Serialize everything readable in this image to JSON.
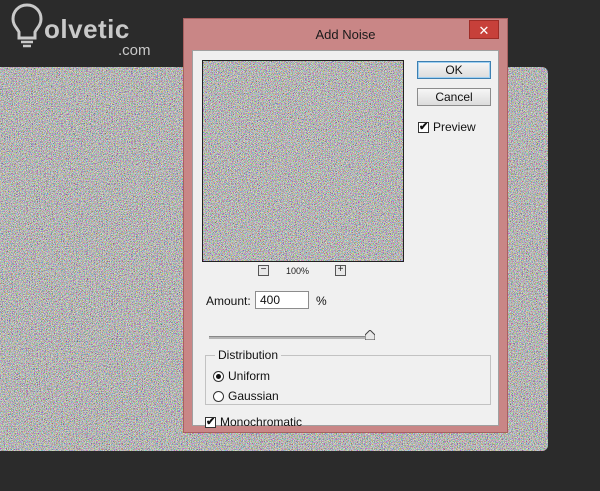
{
  "watermark": {
    "brand": "olvetic",
    "suffix": ".com"
  },
  "dialog": {
    "title": "Add Noise",
    "close_glyph": "✕",
    "buttons": {
      "ok": "OK",
      "cancel": "Cancel"
    },
    "preview": {
      "label": "Preview",
      "checked": true,
      "zoom": "100%",
      "zoom_out": "−",
      "zoom_in": "+"
    },
    "amount": {
      "label": "Amount:",
      "value": "400",
      "unit": "%",
      "slider_fraction": 1.0
    },
    "distribution": {
      "legend": "Distribution",
      "options": [
        {
          "label": "Uniform",
          "selected": true
        },
        {
          "label": "Gaussian",
          "selected": false
        }
      ]
    },
    "monochromatic": {
      "label": "Monochromatic",
      "checked": true
    }
  },
  "colors": {
    "background": "#2b2b2b",
    "dialog_frame": "#c98686",
    "close_button": "#c7403a",
    "client": "#f0f0f0"
  },
  "icons": [
    "bulb-logo-icon",
    "close-icon",
    "zoom-out-icon",
    "zoom-in-icon",
    "checkmark-icon",
    "slider-thumb-icon"
  ]
}
